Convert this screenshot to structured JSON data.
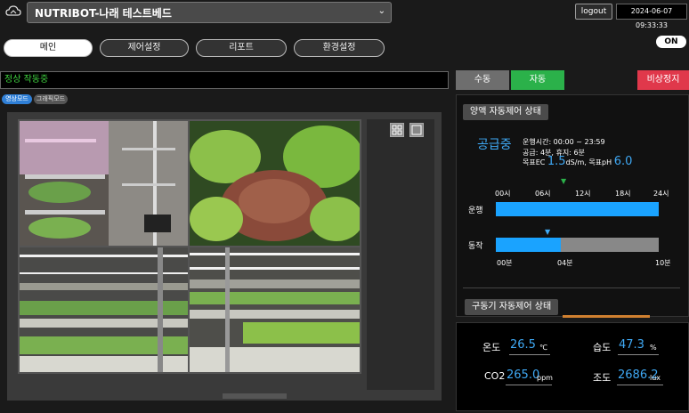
{
  "header": {
    "site_name": "NUTRIBOT-나래 테스트베드",
    "logout_label": "logout",
    "datetime": "2024-06-07 09:33:33"
  },
  "tabs": [
    {
      "label": "메인",
      "active": true
    },
    {
      "label": "제어설정",
      "active": false
    },
    {
      "label": "리포트",
      "active": false
    },
    {
      "label": "환경설정",
      "active": false
    }
  ],
  "toggle_label": "ON",
  "status_text": "정상 작동중",
  "view_modes": {
    "video": "영상모드",
    "graphic": "그래픽모드"
  },
  "mode_buttons": {
    "manual": "수동",
    "auto": "자동",
    "emergency": "비상정지"
  },
  "nutrient": {
    "title": "양액 자동제어 상태",
    "state": "공급중",
    "run_time": "운행시간: 00:00 ~ 23:59",
    "cycle": "공급: 4분, 휴지: 6분",
    "ec_prefix": "목표EC ",
    "ec_value": "1.5",
    "ec_unit": "dS/m, 목표pH ",
    "ph_value": "6.0",
    "hour_ticks": [
      "00시",
      "06시",
      "12시",
      "18시",
      "24시"
    ],
    "run_label": "운행",
    "run_fill": 1.0,
    "run_marker": 0.4,
    "action_label": "동작",
    "action_fill": 0.4,
    "min_ticks": [
      "00분",
      "04분",
      "10분"
    ]
  },
  "motor": {
    "title": "구동기 자동제어 상태"
  },
  "sensors": {
    "temp_label": "온도",
    "temp_value": "26.5",
    "temp_unit": "℃",
    "hum_label": "습도",
    "hum_value": "47.3",
    "hum_unit": "%",
    "co2_label": "CO2",
    "co2_value": "265.0",
    "co2_unit": "ppm",
    "lux_label": "조도",
    "lux_value": "2686.2",
    "lux_unit": "lux"
  },
  "colors": {
    "accent": "#3fa9f5",
    "auto": "#2bb14a",
    "emergency": "#e0384b",
    "status": "#3fd03f"
  }
}
